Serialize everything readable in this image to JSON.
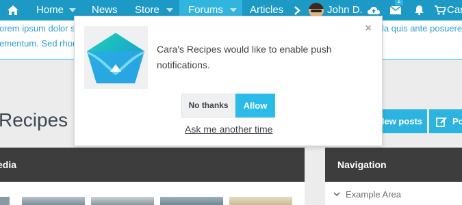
{
  "nav": {
    "items": [
      {
        "label": "Home",
        "caret": true
      },
      {
        "label": "News",
        "caret": false
      },
      {
        "label": "Store",
        "caret": true
      },
      {
        "label": "Forums",
        "caret": true,
        "active": true
      },
      {
        "label": "Articles",
        "caret": false
      }
    ],
    "user_name": "John D.",
    "conversations_badge": "1",
    "cart_label": "Car",
    "icons": [
      "home-icon",
      "chevron-right-icon",
      "upload-icon",
      "envelope-icon",
      "bell-icon",
      "cart-icon"
    ]
  },
  "notice": {
    "line1_left": "orem ipsum dolor si",
    "line2_left": "ementum. Sed rhon",
    "line1_right": "la quis ante posuere"
  },
  "page": {
    "title": "Recipes",
    "new_posts_label": "New posts",
    "post_label": "Po",
    "media_header": "edia",
    "navigation_header": "Navigation",
    "example_area": "Example Area"
  },
  "modal": {
    "message": "Cara's Recipes would like to enable push notifications.",
    "no_thanks": "No thanks",
    "allow": "Allow",
    "ask_later": "Ask me another time",
    "close_symbol": "×"
  },
  "colors": {
    "nav_bg": "#1c9ac5",
    "nav_active": "#31b4de",
    "accent": "#2bbbe8",
    "dark_bar": "#3d3d3d",
    "link_text": "#2c9fd0"
  }
}
